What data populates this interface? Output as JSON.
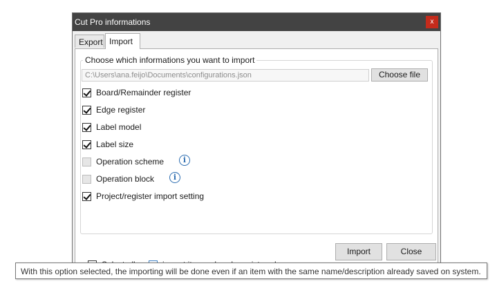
{
  "window": {
    "title": "Cut Pro informations",
    "close_glyph": "x"
  },
  "tabs": [
    {
      "label": "Export",
      "selected": false
    },
    {
      "label": "Import",
      "selected": true
    }
  ],
  "group": {
    "legend": "Choose which informations you want to import",
    "path_value": "C:\\Users\\ana.feijo\\Documents\\configurations.json",
    "choose_label": "Choose file",
    "options": [
      {
        "label": "Board/Remainder register",
        "checked": true,
        "enabled": true,
        "info": false
      },
      {
        "label": "Edge register",
        "checked": true,
        "enabled": true,
        "info": false
      },
      {
        "label": "Label model",
        "checked": true,
        "enabled": true,
        "info": false
      },
      {
        "label": "Label size",
        "checked": true,
        "enabled": true,
        "info": false
      },
      {
        "label": "Operation scheme",
        "checked": false,
        "enabled": false,
        "info": true
      },
      {
        "label": "Operation block",
        "checked": false,
        "enabled": false,
        "info": true
      },
      {
        "label": "Project/register import setting",
        "checked": true,
        "enabled": true,
        "info": false
      }
    ],
    "info_glyph": "i"
  },
  "footer": {
    "select_all_label": "Select all",
    "select_all_state": "indeterminate",
    "import_registered_label": "import items already registered",
    "import_registered_checked": false,
    "import_label": "Import",
    "close_label": "Close"
  },
  "tooltip": {
    "text": "With this option selected, the importing will be done even if an item with the same name/description already saved on system."
  },
  "colors": {
    "titlebar": "#434343",
    "close_button": "#c42b1c",
    "info_icon": "#2b6cb0",
    "checkbox_focus": "#3d7fc1"
  }
}
